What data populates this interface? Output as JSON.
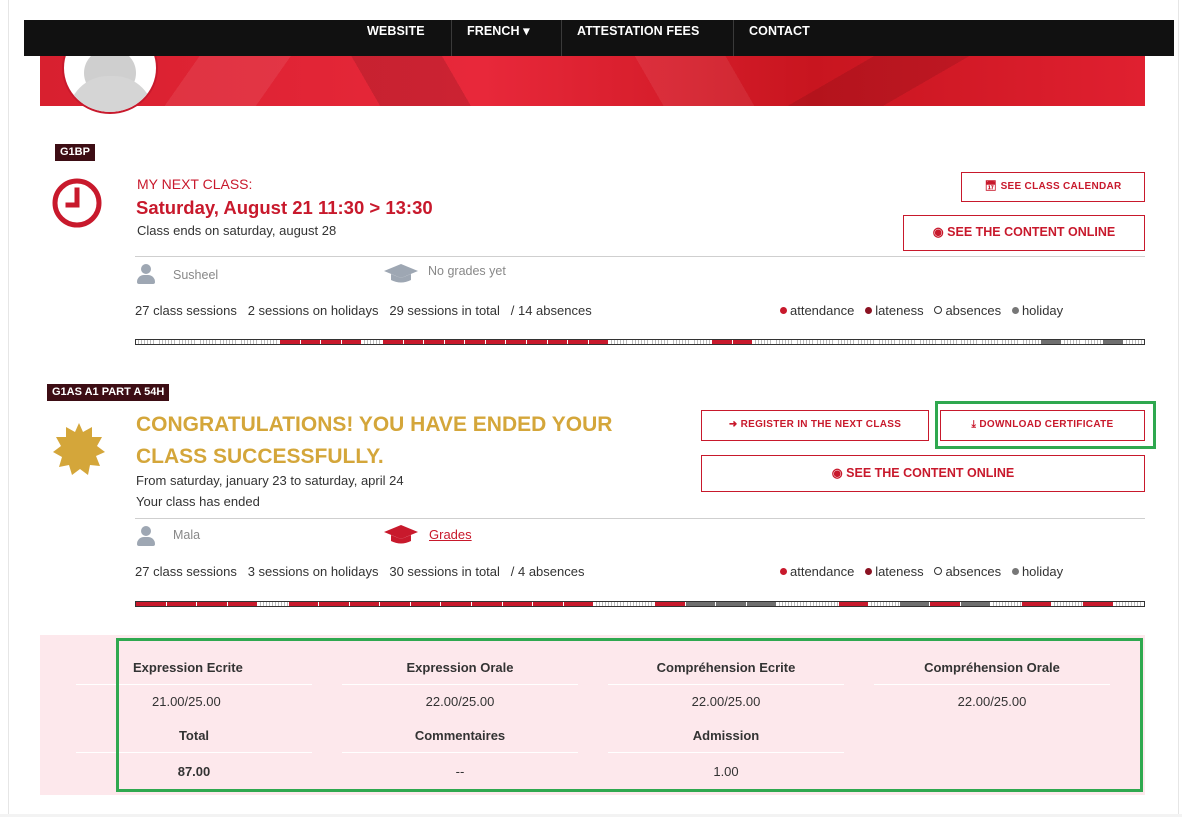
{
  "nav": {
    "items": [
      "WEBSITE",
      "FRENCH ▾",
      "ATTESTATION FEES",
      "CONTACT"
    ]
  },
  "colors": {
    "accent": "#c8192c",
    "gold": "#d4a63a",
    "highlight": "#2fa84f",
    "badge": "#3d0d14",
    "grades_bg": "#fde8ec"
  },
  "class1": {
    "badge": "G1BP",
    "icon": "clock-icon",
    "next_label": "MY NEXT CLASS:",
    "next_time": "Saturday, August 21 11:30 > 13:30",
    "ends_text": "Class ends on saturday, august 28",
    "btn_calendar": "SEE CLASS CALENDAR",
    "btn_content": "SEE THE CONTENT ONLINE",
    "teacher": "Susheel",
    "grades_text": "No grades yet",
    "stats": "27 class sessions   2 sessions on holidays   29 sessions in total   / 14 absences",
    "progress": [
      "absence",
      "absence",
      "absence",
      "absence",
      "absence",
      "absence",
      "absence",
      "attendance",
      "attendance",
      "attendance",
      "attendance",
      "absence",
      "attendance",
      "attendance",
      "attendance",
      "attendance",
      "attendance",
      "attendance",
      "attendance",
      "attendance",
      "attendance",
      "attendance",
      "attendance",
      "absence",
      "absence",
      "absence",
      "absence",
      "absence",
      "attendance",
      "attendance",
      "absence",
      "absence",
      "absence",
      "absence",
      "absence",
      "absence",
      "absence",
      "absence",
      "absence",
      "absence",
      "absence",
      "absence",
      "absence",
      "absence",
      "holiday",
      "absence",
      "absence",
      "holiday",
      "absence"
    ]
  },
  "class2": {
    "badge": "G1AS A1 PART A 54H",
    "icon": "seal-badge-icon",
    "congrats_line1": "CONGRATULATIONS! YOU HAVE ENDED YOUR",
    "congrats_line2": "CLASS SUCCESSFULLY.",
    "dates": "From saturday, january 23 to saturday, april 24",
    "status": "Your class has ended",
    "btn_register": "REGISTER IN THE NEXT CLASS",
    "btn_certificate": "DOWNLOAD CERTIFICATE",
    "btn_content": "SEE THE CONTENT ONLINE",
    "teacher": "Mala",
    "grades_link": "Grades",
    "stats": "27 class sessions   3 sessions on holidays   30 sessions in total   / 4 absences",
    "progress": [
      "attendance",
      "attendance",
      "attendance",
      "attendance",
      "absence",
      "attendance",
      "attendance",
      "attendance",
      "attendance",
      "attendance",
      "attendance",
      "attendance",
      "attendance",
      "attendance",
      "attendance",
      "absence",
      "absence",
      "attendance",
      "holiday",
      "holiday",
      "holiday",
      "absence",
      "absence",
      "attendance",
      "absence",
      "holiday",
      "attendance",
      "holiday",
      "absence",
      "attendance",
      "absence",
      "attendance",
      "absence"
    ]
  },
  "legend": {
    "attendance": "attendance",
    "lateness": "lateness",
    "absences": "absences",
    "holiday": "holiday"
  },
  "grades": {
    "headers": [
      "Expression Ecrite",
      "Expression Orale",
      "Compréhension Ecrite",
      "Compréhension Orale"
    ],
    "values": [
      "21.00/25.00",
      "22.00/25.00",
      "22.00/25.00",
      "22.00/25.00"
    ],
    "headers2": [
      "Total",
      "Commentaires",
      "Admission"
    ],
    "values2": [
      "87.00",
      "--",
      "1.00"
    ]
  }
}
